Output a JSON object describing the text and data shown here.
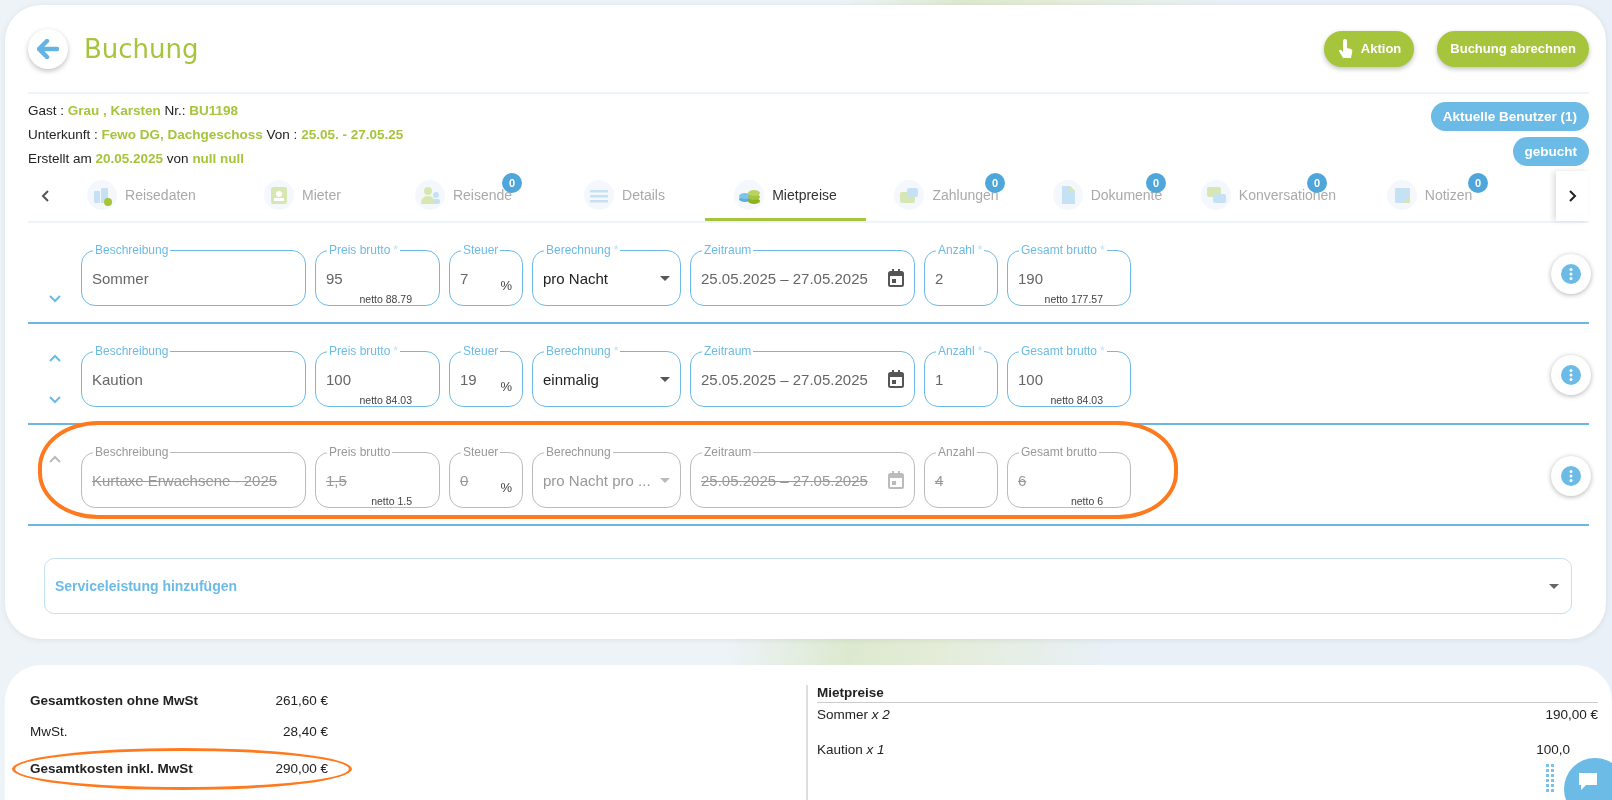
{
  "header": {
    "title": "Buchung",
    "buttons": [
      {
        "label": "Aktion",
        "kind": "action"
      },
      {
        "label": "Buchung abrechnen",
        "kind": "plain"
      }
    ]
  },
  "info_lines": [
    "Gast : **Grau , Karsten** Nr.: **BU1198**",
    "Unterkunft : **Fewo DG, Dachgeschoss** Von : **25.05. - 27.05.25**",
    "Erstellt am **20.05.2025** von **null null**"
  ],
  "status_badges": [
    "Aktuelle Benutzer (1)",
    "gebucht"
  ],
  "tabs": [
    {
      "label": "Reisedaten",
      "selected": false
    },
    {
      "label": "Mieter",
      "selected": false
    },
    {
      "label": "Reisende",
      "badge": "0",
      "selected": false
    },
    {
      "label": "Details",
      "selected": false
    },
    {
      "label": "Mietpreise",
      "selected": true
    },
    {
      "label": "Zahlungen",
      "badge": "0",
      "selected": false
    },
    {
      "label": "Dokumente",
      "badge": "0",
      "selected": false
    },
    {
      "label": "Konversationen",
      "badge": "0",
      "selected": false
    },
    {
      "label": "Notizen",
      "badge": "0",
      "selected": false
    }
  ],
  "price_rows": [
    {
      "disabled": false,
      "highlighted": false,
      "can_move_up": false,
      "can_move_down": true,
      "fields": [
        {
          "kind": "text",
          "label": "Beschreibung",
          "value": "Sommer"
        },
        {
          "kind": "text",
          "label": "Preis brutto",
          "required_mark": "*",
          "value": "95",
          "note": "netto 88.79"
        },
        {
          "kind": "percent",
          "label": "Steuer",
          "value": "7",
          "suffix": "%"
        },
        {
          "kind": "select",
          "label": "Berechnung",
          "required_mark": "*",
          "value": "pro Nacht"
        },
        {
          "kind": "date",
          "label": "Zeitraum",
          "value": "25.05.2025 – 27.05.2025"
        },
        {
          "kind": "text",
          "label": "Anzahl",
          "required_mark": "*",
          "value": "2"
        },
        {
          "kind": "text",
          "label": "Gesamt brutto",
          "required_mark": "*",
          "value": "190",
          "note": "netto 177.57"
        }
      ]
    },
    {
      "disabled": false,
      "highlighted": false,
      "can_move_up": true,
      "can_move_down": true,
      "fields": [
        {
          "kind": "text",
          "label": "Beschreibung",
          "value": "Kaution"
        },
        {
          "kind": "text",
          "label": "Preis brutto",
          "required_mark": "*",
          "value": "100",
          "note": "netto 84.03"
        },
        {
          "kind": "percent",
          "label": "Steuer",
          "value": "19",
          "suffix": "%"
        },
        {
          "kind": "select",
          "label": "Berechnung",
          "required_mark": "*",
          "value": "einmalig"
        },
        {
          "kind": "date",
          "label": "Zeitraum",
          "value": "25.05.2025 – 27.05.2025"
        },
        {
          "kind": "text",
          "label": "Anzahl",
          "required_mark": "*",
          "value": "1"
        },
        {
          "kind": "text",
          "label": "Gesamt brutto",
          "required_mark": "*",
          "value": "100",
          "note": "netto 84.03"
        }
      ]
    },
    {
      "disabled": true,
      "highlighted": true,
      "can_move_up": true,
      "can_move_down": false,
      "fields": [
        {
          "kind": "text",
          "label": "Beschreibung",
          "value": "Kurtaxe Erwachsene - 2025"
        },
        {
          "kind": "text",
          "label": "Preis brutto",
          "value": "1,5",
          "note": "netto 1.5"
        },
        {
          "kind": "percent",
          "label": "Steuer",
          "value": "0",
          "suffix": "%"
        },
        {
          "kind": "select",
          "label": "Berechnung",
          "value": "pro Nacht pro ..."
        },
        {
          "kind": "date",
          "label": "Zeitraum",
          "value": "25.05.2025 – 27.05.2025"
        },
        {
          "kind": "text",
          "label": "Anzahl",
          "value": "4"
        },
        {
          "kind": "text",
          "label": "Gesamt brutto",
          "value": "6",
          "note": "netto 6"
        }
      ]
    }
  ],
  "service_select": {
    "label": "Serviceleistung hinzufügen"
  },
  "summary": {
    "totals": [
      {
        "label": "Gesamtkosten ohne MwSt",
        "value": "261,60 €",
        "emphasized": true,
        "highlighted": false
      },
      {
        "label": "MwSt.",
        "value": "28,40 €",
        "emphasized": false,
        "highlighted": false
      },
      {
        "label": "Gesamtkosten inkl. MwSt",
        "value": "290,00 €",
        "emphasized": true,
        "highlighted": true
      }
    ],
    "breakdown": {
      "title": "Mietpreise",
      "items": [
        {
          "text": "Sommer *x 2*",
          "value": "190,00 €"
        },
        {
          "text": "Kaution *x 1*",
          "value": "100,0"
        }
      ]
    }
  }
}
